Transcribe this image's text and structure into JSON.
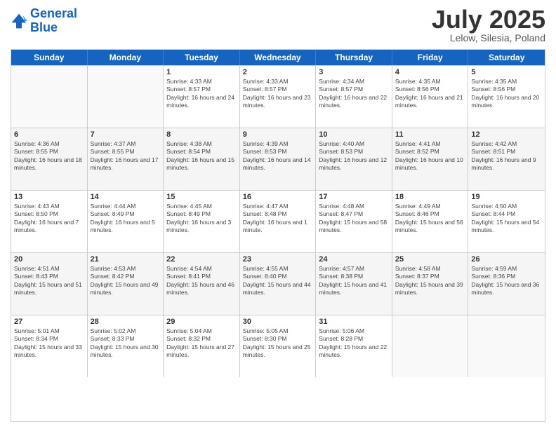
{
  "header": {
    "logo_line1": "General",
    "logo_line2": "Blue",
    "month": "July 2025",
    "location": "Lelow, Silesia, Poland"
  },
  "days": [
    "Sunday",
    "Monday",
    "Tuesday",
    "Wednesday",
    "Thursday",
    "Friday",
    "Saturday"
  ],
  "weeks": [
    [
      {
        "day": "",
        "sunrise": "",
        "sunset": "",
        "daylight": "",
        "empty": true
      },
      {
        "day": "",
        "sunrise": "",
        "sunset": "",
        "daylight": "",
        "empty": true
      },
      {
        "day": "1",
        "sunrise": "Sunrise: 4:33 AM",
        "sunset": "Sunset: 8:57 PM",
        "daylight": "Daylight: 16 hours and 24 minutes.",
        "empty": false
      },
      {
        "day": "2",
        "sunrise": "Sunrise: 4:33 AM",
        "sunset": "Sunset: 8:57 PM",
        "daylight": "Daylight: 16 hours and 23 minutes.",
        "empty": false
      },
      {
        "day": "3",
        "sunrise": "Sunrise: 4:34 AM",
        "sunset": "Sunset: 8:57 PM",
        "daylight": "Daylight: 16 hours and 22 minutes.",
        "empty": false
      },
      {
        "day": "4",
        "sunrise": "Sunrise: 4:35 AM",
        "sunset": "Sunset: 8:56 PM",
        "daylight": "Daylight: 16 hours and 21 minutes.",
        "empty": false
      },
      {
        "day": "5",
        "sunrise": "Sunrise: 4:35 AM",
        "sunset": "Sunset: 8:56 PM",
        "daylight": "Daylight: 16 hours and 20 minutes.",
        "empty": false
      }
    ],
    [
      {
        "day": "6",
        "sunrise": "Sunrise: 4:36 AM",
        "sunset": "Sunset: 8:55 PM",
        "daylight": "Daylight: 16 hours and 18 minutes.",
        "empty": false
      },
      {
        "day": "7",
        "sunrise": "Sunrise: 4:37 AM",
        "sunset": "Sunset: 8:55 PM",
        "daylight": "Daylight: 16 hours and 17 minutes.",
        "empty": false
      },
      {
        "day": "8",
        "sunrise": "Sunrise: 4:38 AM",
        "sunset": "Sunset: 8:54 PM",
        "daylight": "Daylight: 16 hours and 15 minutes.",
        "empty": false
      },
      {
        "day": "9",
        "sunrise": "Sunrise: 4:39 AM",
        "sunset": "Sunset: 8:53 PM",
        "daylight": "Daylight: 16 hours and 14 minutes.",
        "empty": false
      },
      {
        "day": "10",
        "sunrise": "Sunrise: 4:40 AM",
        "sunset": "Sunset: 8:53 PM",
        "daylight": "Daylight: 16 hours and 12 minutes.",
        "empty": false
      },
      {
        "day": "11",
        "sunrise": "Sunrise: 4:41 AM",
        "sunset": "Sunset: 8:52 PM",
        "daylight": "Daylight: 16 hours and 10 minutes.",
        "empty": false
      },
      {
        "day": "12",
        "sunrise": "Sunrise: 4:42 AM",
        "sunset": "Sunset: 8:51 PM",
        "daylight": "Daylight: 16 hours and 9 minutes.",
        "empty": false
      }
    ],
    [
      {
        "day": "13",
        "sunrise": "Sunrise: 4:43 AM",
        "sunset": "Sunset: 8:50 PM",
        "daylight": "Daylight: 16 hours and 7 minutes.",
        "empty": false
      },
      {
        "day": "14",
        "sunrise": "Sunrise: 4:44 AM",
        "sunset": "Sunset: 8:49 PM",
        "daylight": "Daylight: 16 hours and 5 minutes.",
        "empty": false
      },
      {
        "day": "15",
        "sunrise": "Sunrise: 4:45 AM",
        "sunset": "Sunset: 8:49 PM",
        "daylight": "Daylight: 16 hours and 3 minutes.",
        "empty": false
      },
      {
        "day": "16",
        "sunrise": "Sunrise: 4:47 AM",
        "sunset": "Sunset: 8:48 PM",
        "daylight": "Daylight: 16 hours and 1 minute.",
        "empty": false
      },
      {
        "day": "17",
        "sunrise": "Sunrise: 4:48 AM",
        "sunset": "Sunset: 8:47 PM",
        "daylight": "Daylight: 15 hours and 58 minutes.",
        "empty": false
      },
      {
        "day": "18",
        "sunrise": "Sunrise: 4:49 AM",
        "sunset": "Sunset: 8:46 PM",
        "daylight": "Daylight: 15 hours and 56 minutes.",
        "empty": false
      },
      {
        "day": "19",
        "sunrise": "Sunrise: 4:50 AM",
        "sunset": "Sunset: 8:44 PM",
        "daylight": "Daylight: 15 hours and 54 minutes.",
        "empty": false
      }
    ],
    [
      {
        "day": "20",
        "sunrise": "Sunrise: 4:51 AM",
        "sunset": "Sunset: 8:43 PM",
        "daylight": "Daylight: 15 hours and 51 minutes.",
        "empty": false
      },
      {
        "day": "21",
        "sunrise": "Sunrise: 4:53 AM",
        "sunset": "Sunset: 8:42 PM",
        "daylight": "Daylight: 15 hours and 49 minutes.",
        "empty": false
      },
      {
        "day": "22",
        "sunrise": "Sunrise: 4:54 AM",
        "sunset": "Sunset: 8:41 PM",
        "daylight": "Daylight: 15 hours and 46 minutes.",
        "empty": false
      },
      {
        "day": "23",
        "sunrise": "Sunrise: 4:55 AM",
        "sunset": "Sunset: 8:40 PM",
        "daylight": "Daylight: 15 hours and 44 minutes.",
        "empty": false
      },
      {
        "day": "24",
        "sunrise": "Sunrise: 4:57 AM",
        "sunset": "Sunset: 8:38 PM",
        "daylight": "Daylight: 15 hours and 41 minutes.",
        "empty": false
      },
      {
        "day": "25",
        "sunrise": "Sunrise: 4:58 AM",
        "sunset": "Sunset: 8:37 PM",
        "daylight": "Daylight: 15 hours and 39 minutes.",
        "empty": false
      },
      {
        "day": "26",
        "sunrise": "Sunrise: 4:59 AM",
        "sunset": "Sunset: 8:36 PM",
        "daylight": "Daylight: 15 hours and 36 minutes.",
        "empty": false
      }
    ],
    [
      {
        "day": "27",
        "sunrise": "Sunrise: 5:01 AM",
        "sunset": "Sunset: 8:34 PM",
        "daylight": "Daylight: 15 hours and 33 minutes.",
        "empty": false
      },
      {
        "day": "28",
        "sunrise": "Sunrise: 5:02 AM",
        "sunset": "Sunset: 8:33 PM",
        "daylight": "Daylight: 15 hours and 30 minutes.",
        "empty": false
      },
      {
        "day": "29",
        "sunrise": "Sunrise: 5:04 AM",
        "sunset": "Sunset: 8:32 PM",
        "daylight": "Daylight: 15 hours and 27 minutes.",
        "empty": false
      },
      {
        "day": "30",
        "sunrise": "Sunrise: 5:05 AM",
        "sunset": "Sunset: 8:30 PM",
        "daylight": "Daylight: 15 hours and 25 minutes.",
        "empty": false
      },
      {
        "day": "31",
        "sunrise": "Sunrise: 5:06 AM",
        "sunset": "Sunset: 8:28 PM",
        "daylight": "Daylight: 15 hours and 22 minutes.",
        "empty": false
      },
      {
        "day": "",
        "sunrise": "",
        "sunset": "",
        "daylight": "",
        "empty": true
      },
      {
        "day": "",
        "sunrise": "",
        "sunset": "",
        "daylight": "",
        "empty": true
      }
    ]
  ]
}
